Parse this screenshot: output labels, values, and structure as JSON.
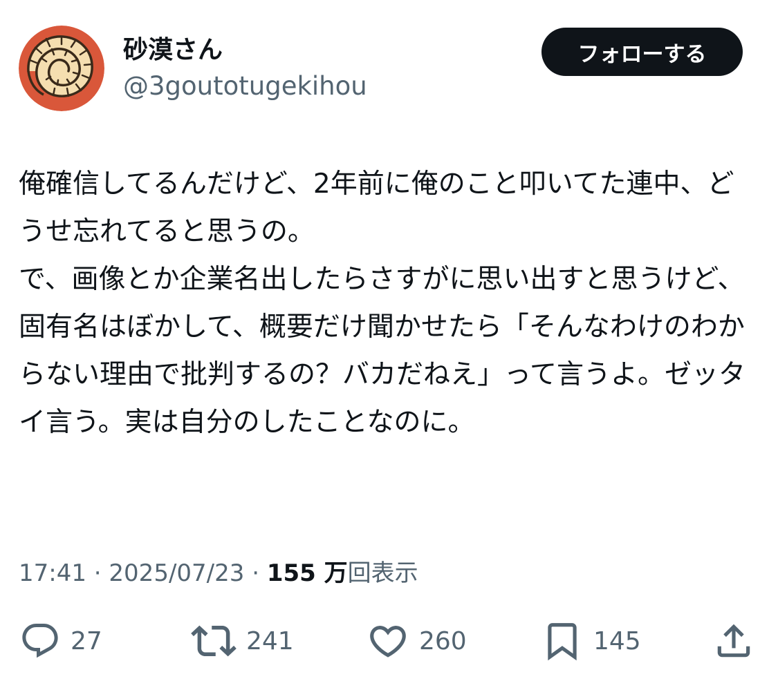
{
  "author": {
    "display_name": "砂漠さん",
    "handle": "@3goutotugekihou"
  },
  "follow_label": "フォローする",
  "tweet": {
    "text": "俺確信してるんだけど、2年前に俺のこと叩いてた連中、どうせ忘れてると思うの。\nで、画像とか企業名出したらさすがに思い出すと思うけど、固有名はぼかして、概要だけ聞かせたら「そんなわけのわからない理由で批判するの？バカだねえ」って言うよ。ゼッタイ言う。実は自分のしたことなのに。"
  },
  "meta": {
    "time": "17:41",
    "date": "2025/07/23",
    "views_count": "155 万",
    "views_label": "回表示",
    "separator": " · "
  },
  "actions": {
    "replies": "27",
    "reposts": "241",
    "likes": "260",
    "bookmarks": "145"
  },
  "icons": {
    "avatar": "ammonite-shell-avatar",
    "reply": "speech-bubble-icon",
    "repost": "repost-arrows-icon",
    "like": "heart-icon",
    "bookmark": "bookmark-icon",
    "share": "share-upload-icon"
  },
  "colors": {
    "avatar_bg": "#d9573a",
    "avatar_shell": "#f5deb0",
    "button_bg": "#0f1419",
    "text_primary": "#0f1419",
    "text_secondary": "#536471"
  }
}
